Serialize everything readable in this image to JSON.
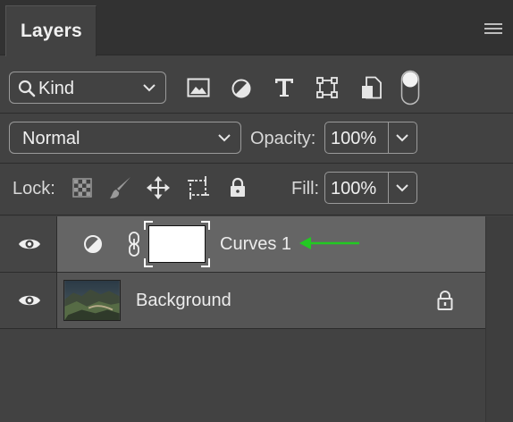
{
  "panel": {
    "tab_title": "Layers",
    "menu_icon": "hamburger-menu-icon"
  },
  "filter": {
    "search_icon": "magnifier-icon",
    "kind_label": "Kind",
    "filter_icons": [
      "pixel-layer-filter-icon",
      "adjustment-layer-filter-icon",
      "type-layer-filter-icon",
      "shape-layer-filter-icon",
      "smart-object-filter-icon"
    ],
    "toggle_icon": "filter-toggle-icon"
  },
  "blend": {
    "mode": "Normal",
    "opacity_label": "Opacity:",
    "opacity_value": "100%"
  },
  "lock": {
    "label": "Lock:",
    "icons": [
      "lock-transparent-pixels-icon",
      "lock-image-pixels-icon",
      "lock-position-icon",
      "lock-artboard-icon",
      "lock-all-icon"
    ],
    "fill_label": "Fill:",
    "fill_value": "100%"
  },
  "layers": [
    {
      "name": "Curves 1",
      "type": "adjustment",
      "visible": true,
      "selected": true,
      "annotation_color": "#22c922"
    },
    {
      "name": "Background",
      "type": "image",
      "visible": true,
      "selected": false,
      "locked": true
    }
  ],
  "colors": {
    "panel_bg": "#424242",
    "selected_row": "#656565",
    "arrow": "#22c922"
  }
}
